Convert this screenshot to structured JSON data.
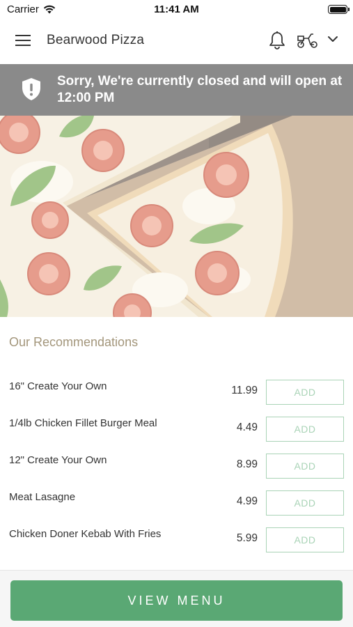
{
  "status_bar": {
    "carrier": "Carrier",
    "time": "11:41 AM"
  },
  "header": {
    "title": "Bearwood Pizza",
    "icons": [
      "menu-icon",
      "bell-icon",
      "scooter-icon",
      "chevron-down-icon"
    ]
  },
  "banner": {
    "message": "Sorry, We're currently closed and will open at 12:00 PM",
    "icon": "shield-alert-icon",
    "color": "#8a8a8a"
  },
  "hero": {
    "image": "pizza-photo"
  },
  "recommendations": {
    "title": "Our Recommendations",
    "items": [
      {
        "name": "16\" Create Your Own",
        "price": "11.99",
        "button": "ADD"
      },
      {
        "name": "1/4lb Chicken Fillet Burger Meal",
        "price": "4.49",
        "button": "ADD"
      },
      {
        "name": "12\" Create Your Own",
        "price": "8.99",
        "button": "ADD"
      },
      {
        "name": "Meat Lasagne",
        "price": "4.99",
        "button": "ADD"
      },
      {
        "name": "Chicken Doner Kebab With Fries",
        "price": "5.99",
        "button": "ADD"
      }
    ]
  },
  "footer": {
    "view_menu_label": "VIEW MENU",
    "accent_color": "#5aa874"
  }
}
